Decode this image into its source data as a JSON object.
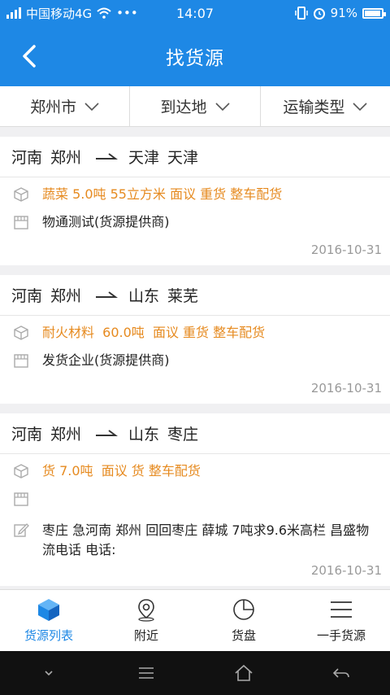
{
  "status_bar": {
    "carrier": "中国移动4G",
    "more": "•••",
    "time": "14:07",
    "battery": "91%"
  },
  "header": {
    "title": "找货源"
  },
  "filters": [
    {
      "label": "郑州市"
    },
    {
      "label": "到达地"
    },
    {
      "label": "运输类型"
    }
  ],
  "listings": [
    {
      "from_province": "河南",
      "from_city": "郑州",
      "to_province": "天津",
      "to_city": "天津",
      "cargo": "蔬菜 5.0吨 55立方米 面议 重货 整车配货",
      "provider": "物通测试(货源提供商)",
      "date": "2016-10-31"
    },
    {
      "from_province": "河南",
      "from_city": "郑州",
      "to_province": "山东",
      "to_city": "莱芜",
      "cargo": "耐火材料  60.0吨  面议 重货 整车配货",
      "provider": "发货企业(货源提供商)",
      "date": "2016-10-31"
    },
    {
      "from_province": "河南",
      "from_city": "郑州",
      "to_province": "山东",
      "to_city": "枣庄",
      "cargo": "货 7.0吨  面议 货 整车配货",
      "provider": "",
      "note": "枣庄 急河南 郑州 回回枣庄 薛城 7吨求9.6米高栏 昌盛物流电话 电话:",
      "date": "2016-10-31"
    }
  ],
  "tabs": [
    {
      "label": "货源列表",
      "icon": "cube-icon"
    },
    {
      "label": "附近",
      "icon": "location-pin-icon"
    },
    {
      "label": "货盘",
      "icon": "pie-chart-icon"
    },
    {
      "label": "一手货源",
      "icon": "menu-lines-icon"
    }
  ],
  "colors": {
    "primary": "#1e88e5",
    "accent": "#e68a1f",
    "muted": "#999999"
  }
}
